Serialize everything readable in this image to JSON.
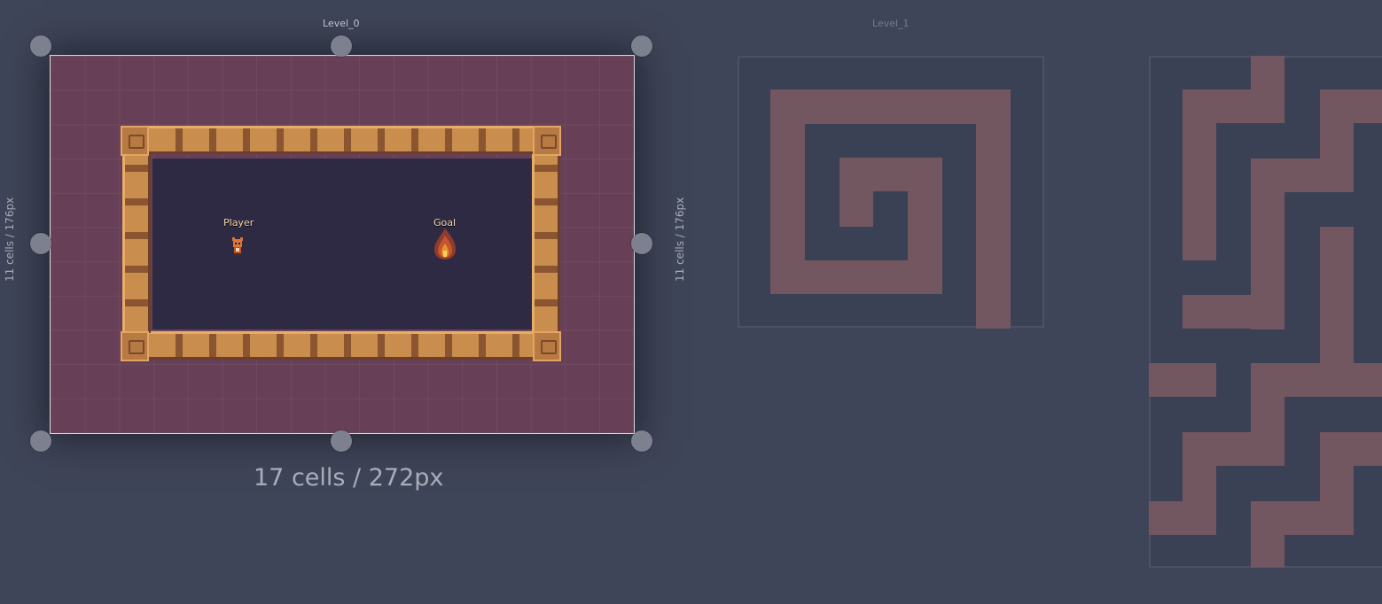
{
  "levels": [
    {
      "name": "Level_0",
      "width_label": "17 cells / 272px",
      "height_label": "11 cells / 176px",
      "selected": true
    },
    {
      "name": "Level_1"
    }
  ],
  "entities": [
    {
      "name": "Player"
    },
    {
      "name": "Goal"
    }
  ],
  "colors": {
    "canvas_bg": "#3f4558",
    "selected_level_bg": "#673f56",
    "room_floor": "#2f2a43",
    "wall": "#c98d4d",
    "minimap_level_bg": "#3b4154",
    "minimap_wall": "#725660",
    "handle": "#7d818f"
  },
  "icons": [
    "player-sprite-icon",
    "goal-fire-icon",
    "resize-handle-icon"
  ]
}
